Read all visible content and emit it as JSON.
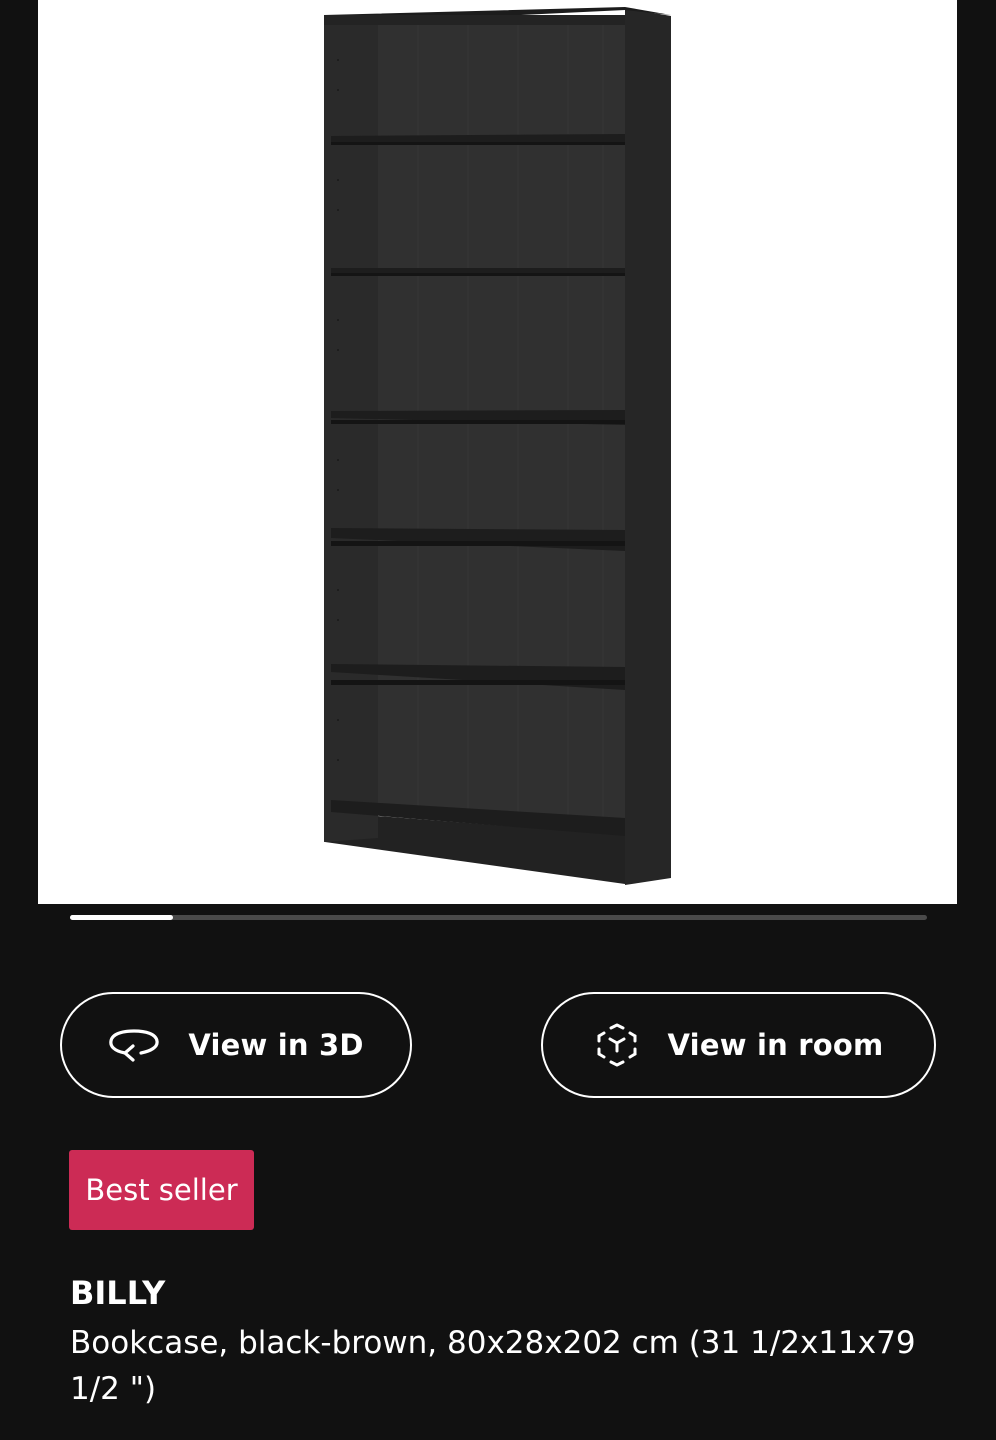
{
  "product_image": {
    "icon": "bookcase-image",
    "background": "#ffffff",
    "furniture_color": "#2b2b2b"
  },
  "carousel": {
    "progress": 0.12
  },
  "actions": {
    "view_3d_label": "View in 3D",
    "view_3d_icon": "rotate-3d-icon",
    "view_room_label": "View in room",
    "view_room_icon": "augmented-reality-icon"
  },
  "badge": {
    "text": "Best seller",
    "color": "#cc2b55"
  },
  "product": {
    "name": "BILLY",
    "description": "Bookcase, black-brown, 80x28x202 cm (31 1/2x11x79 1/2 \")"
  }
}
